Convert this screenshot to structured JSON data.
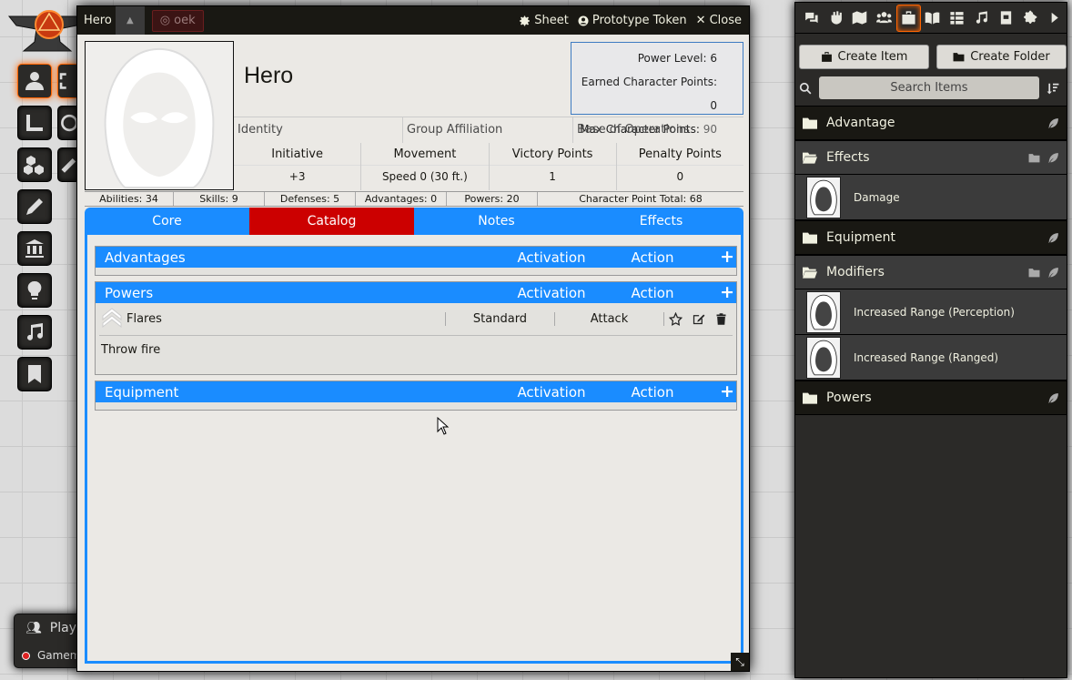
{
  "sheet": {
    "window_title": "Hero",
    "token_badge": "oek",
    "links": {
      "sheet": "Sheet",
      "prototype": "Prototype Token",
      "close": "Close"
    },
    "name": "Hero",
    "points": {
      "power_level_label": "Power Level:",
      "power_level": "6",
      "earned_label": "Earned Character Points:",
      "earned": "0",
      "max_label": "Max Character Points:",
      "max": "90"
    },
    "identity": [
      "Identity",
      "Group Affiliation",
      "Base of Operations"
    ],
    "stats": [
      {
        "label": "Initiative",
        "value": "+3"
      },
      {
        "label": "Movement",
        "value": "Speed 0 (30 ft.)"
      },
      {
        "label": "Victory Points",
        "value": "1"
      },
      {
        "label": "Penalty Points",
        "value": "0"
      }
    ],
    "summary": [
      "Abilities: 34",
      "Skills: 9",
      "Defenses: 5",
      "Advantages: 0",
      "Powers: 20",
      "Character Point Total: 68"
    ],
    "tabs": [
      "Core",
      "Catalog",
      "Notes",
      "Effects"
    ],
    "active_tab": "Catalog",
    "sections": {
      "advantages": {
        "title": "Advantages",
        "col1": "Activation",
        "col2": "Action",
        "add": "+"
      },
      "powers": {
        "title": "Powers",
        "col1": "Activation",
        "col2": "Action",
        "add": "+"
      },
      "equipment": {
        "title": "Equipment",
        "col1": "Activation",
        "col2": "Action",
        "add": "+"
      }
    },
    "power_item": {
      "name": "Flares",
      "activation": "Standard",
      "action": "Attack",
      "description": "Throw fire"
    }
  },
  "players": {
    "title": "Play",
    "user": "Gamem"
  },
  "sidebar": {
    "create_item": "Create Item",
    "create_folder": "Create Folder",
    "search_placeholder": "Search Items",
    "folders": {
      "advantage": "Advantage",
      "effects": "Effects",
      "effects_items": [
        "Damage"
      ],
      "equipment": "Equipment",
      "modifiers": "Modifiers",
      "modifiers_items": [
        "Increased Range (Perception)",
        "Increased Range (Ranged)"
      ],
      "powers": "Powers"
    }
  },
  "colors": {
    "accent": "#1a8cff",
    "active_tab": "#cc0000",
    "highlight": "#ff6400"
  }
}
